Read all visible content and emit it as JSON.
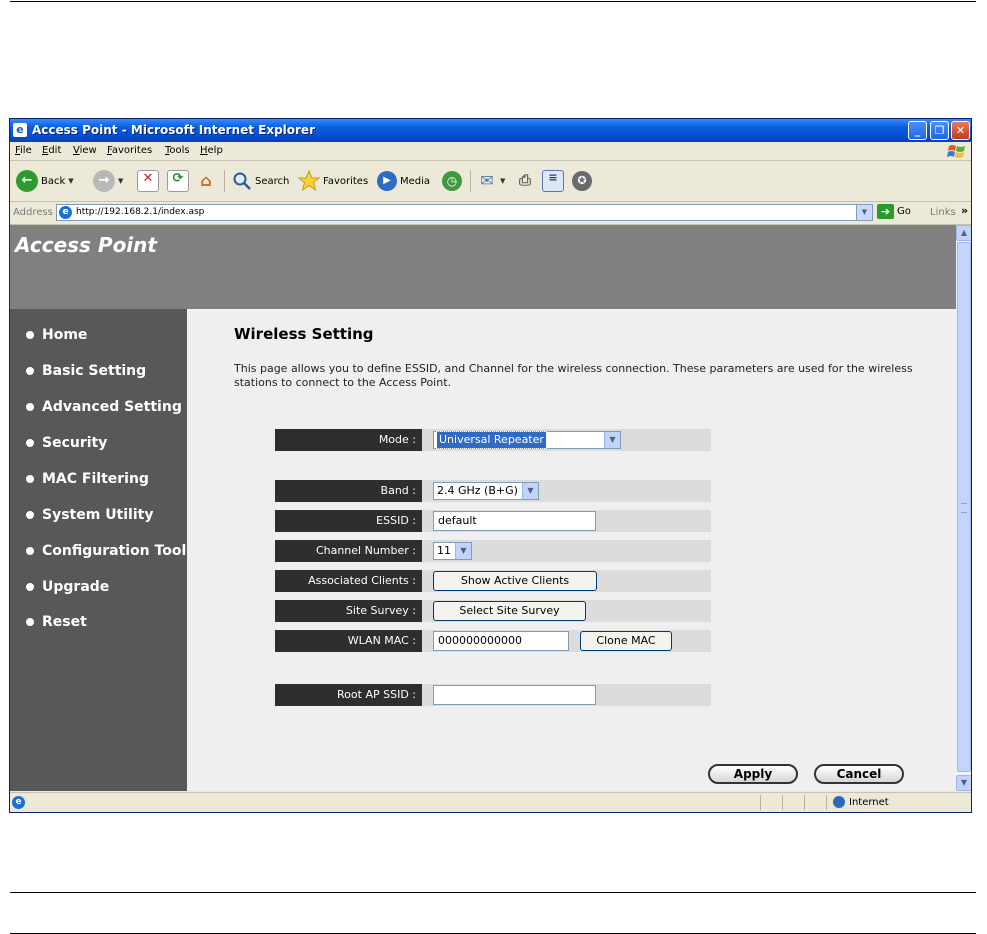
{
  "window": {
    "title": "Access Point - Microsoft Internet Explorer",
    "title_icon": "ie-page-icon",
    "controls": [
      "minimize",
      "maximize",
      "close"
    ]
  },
  "menubar": {
    "items": [
      "File",
      "Edit",
      "View",
      "Favorites",
      "Tools",
      "Help"
    ]
  },
  "toolbar": {
    "back_label": "Back",
    "search_label": "Search",
    "favorites_label": "Favorites",
    "media_label": "Media"
  },
  "addressbar": {
    "label": "Address",
    "url": "http://192.168.2.1/index.asp",
    "go_label": "Go",
    "links_label": "Links"
  },
  "page": {
    "brand": "Access Point",
    "nav": [
      "Home",
      "Basic Setting",
      "Advanced Setting",
      "Security",
      "MAC Filtering",
      "System Utility",
      "Configuration Tool",
      "Upgrade",
      "Reset"
    ],
    "title": "Wireless Setting",
    "description": "This page allows you to define ESSID, and Channel for the wireless connection. These parameters are used for the wireless stations to connect to the Access Point.",
    "form": {
      "mode_label": "Mode :",
      "mode_value": "Universal Repeater",
      "band_label": "Band :",
      "band_value": "2.4 GHz (B+G)",
      "essid_label": "ESSID :",
      "essid_value": "default",
      "channel_label": "Channel Number :",
      "channel_value": "11",
      "clients_label": "Associated Clients :",
      "clients_button": "Show Active Clients",
      "survey_label": "Site Survey :",
      "survey_button": "Select Site Survey",
      "wlan_mac_label": "WLAN MAC :",
      "wlan_mac_value": "000000000000",
      "clone_mac_button": "Clone MAC",
      "root_ssid_label": "Root AP SSID :",
      "root_ssid_value": ""
    },
    "apply_label": "Apply",
    "cancel_label": "Cancel"
  },
  "statusbar": {
    "zone": "Internet"
  },
  "colors": {
    "titlebar": "#0550d8",
    "header_bg": "#808080",
    "sidebar_bg": "#585858",
    "label_bg": "#2e2e2e",
    "main_bg": "#efefef"
  }
}
